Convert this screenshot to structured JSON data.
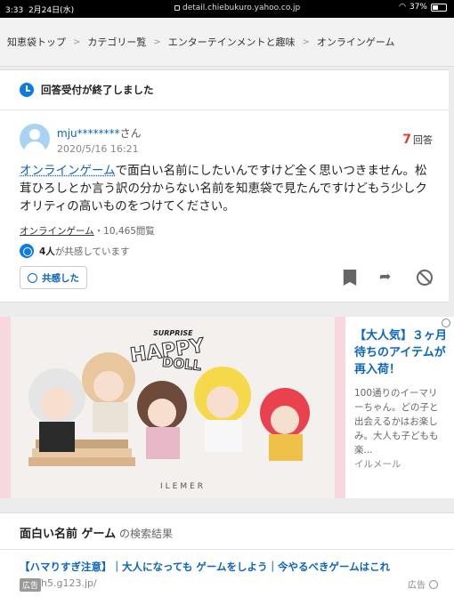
{
  "status_bar": {
    "time": "3:33",
    "date": "2月24日(水)",
    "url": "detail.chiebukuro.yahoo.co.jp",
    "battery": "37%"
  },
  "breadcrumb": [
    "知恵袋トップ",
    "カテゴリー覧",
    "エンターテインメントと趣味",
    "オンラインゲーム"
  ],
  "question": {
    "closed_label": "回答受付が終了しました",
    "user": "mju********",
    "user_suffix": "さん",
    "date": "2020/5/16 16:21",
    "answer_count": "7",
    "answer_label": "回答",
    "body_link": "オンラインゲーム",
    "body_text": "で面白い名前にしたいんですけど全く思いつきません。松茸ひろしとか言う訳の分からない名前を知恵袋で見たんですけどもう少しクオリティの高いものをつけてください。",
    "category": "オンラインゲーム",
    "views": "・10,465閲覧",
    "empathy_count": "4人",
    "empathy_text": "が共感しています",
    "empathy_button": "共感した"
  },
  "ad": {
    "surprise": "SURPRISE",
    "happy": "HAPPY",
    "doll": "DOLL",
    "brand": "ILEMER",
    "title": "【大人気】３ヶ月待ちのアイテムが再入荷！",
    "desc": "100通りのイーマリーちゃん。どの子と出会えるかはお楽しみ。大人も子どもも楽...",
    "advertiser": "イルメール"
  },
  "results": {
    "query": "面白い名前 ゲーム",
    "suffix": " の検索結果",
    "link_text": "【ハマりすぎ注意】｜大人になっても ゲームをしよう｜今やるべきゲームはこれ",
    "ad_tag": "広告",
    "domain": "h5.g123.jp/",
    "ad_label": "広告"
  },
  "colors": {
    "link": "#0b64c0",
    "accent_red": "#e03a2a",
    "icon_blue": "#0c7be6"
  }
}
